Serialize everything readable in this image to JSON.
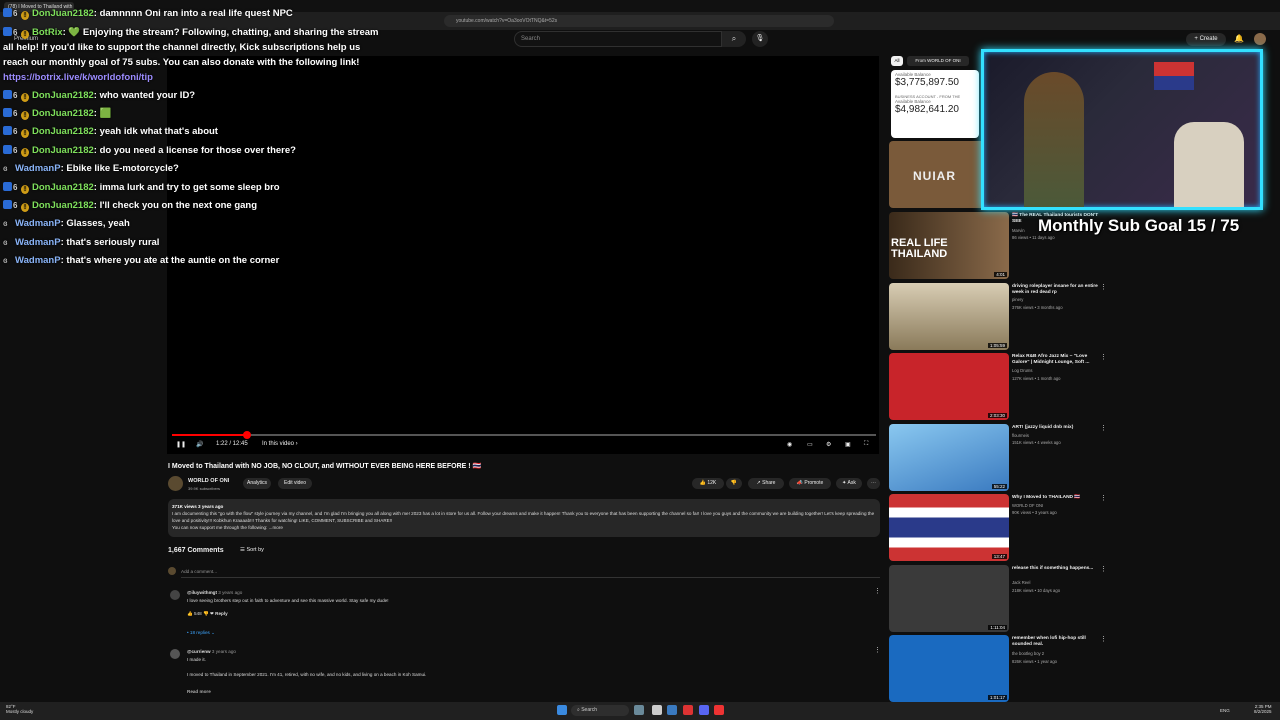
{
  "browser": {
    "tab_title": "(78) I Moved to Thailand with N...",
    "url": "youtube.com/watch?v=Oa3ooVOtTNQ&t=52s"
  },
  "youtube": {
    "search_placeholder": "Search",
    "create_label": "Create",
    "premium_label": "Premium",
    "player": {
      "time": "1:22 / 12:45",
      "chapter": "In this video ›"
    },
    "video_title": "I Moved to Thailand with NO JOB, NO CLOUT, and WITHOUT EVER BEING HERE BEFORE ! 🇹🇭",
    "channel_name": "WORLD OF ONI",
    "subscribers": "39.9K subscribers",
    "analytics_label": "Analytics",
    "edit_label": "Edit video",
    "likes": "12K",
    "share_label": "Share",
    "promote_label": "Promote",
    "ask_label": "Ask",
    "description": {
      "stats": "371K views  3 years ago",
      "text": "I am documenting this \"go with the flow\" style journey via my channel, and I'm glad I'm bringing you all along with me! 2023 has a lot in store for us all. Follow your dreams and make it happen! Thank you to everyone that has been supporting the channel so far! I love you guys and the community we are building together! Let's keep spreading the love and positivity!!! Kobkhun Kraaaab!!! Thanks for watching! LIKE, COMMENT, SUBSCRIBE and SHARE!!",
      "text2": "You can now support me through the following: ...more"
    },
    "comments": {
      "count": "1,667 Comments",
      "sort_label": "Sort by",
      "add_placeholder": "Add a comment...",
      "items": [
        {
          "author": "@iluywithmgt",
          "time": "3 years ago",
          "text": "I love seeing brothers step out in faith to adventure and see this massive world. Stay safe my dude!",
          "likes": "548",
          "reply_label": "Reply",
          "replies": "18 replies"
        },
        {
          "author": "@currienw",
          "time": "3 years ago",
          "text": "I made it.",
          "text2": "I moved to Thailand in September 2021.  I'm 41, retired, with no wife, and no kids, and living on a beach in Koh Samui.",
          "read_more": "Read more"
        }
      ]
    },
    "chips": {
      "all": "All",
      "from": "From WORLD OF ONI"
    },
    "recommended": [
      {
        "title": "",
        "channel": "",
        "meta": "",
        "duration": "",
        "thumb_color": "#7a5a3a"
      },
      {
        "title": "🇹🇭 The REAL Thailand tourists DON'T SEE",
        "channel": "Marvin",
        "meta": "86 views • 11 days ago",
        "duration": "4:01",
        "thumb_color": "#3a2a1a",
        "thumb_text": "REAL LIFE THAILAND"
      },
      {
        "title": "driving roleplayer insane for an entire week in red dead rp",
        "channel": "pinery",
        "meta": "376K views • 3 months ago",
        "duration": "1:05:59",
        "thumb_color": "#b4a58a"
      },
      {
        "title": "Relax R&B Afro Jazz Mix ~ \"Love Galore\" | Midnight Lounge, Soft ...",
        "channel": "Log Drums",
        "meta": "127K views • 1 month ago",
        "duration": "2:03:30",
        "thumb_color": "#c8242a"
      },
      {
        "title": "ART! (jazzy liquid dnb mix)",
        "channel": "flourmeis",
        "meta": "151K views • 4 weeks ago",
        "duration": "55:22",
        "thumb_color": "#5aa0e0"
      },
      {
        "title": "Why I Moved to THAILAND 🇹🇭",
        "channel": "WORLD OF ONI",
        "meta": "90K views • 3 years ago",
        "duration": "13:47",
        "thumb_color": "#2a3a6a"
      },
      {
        "title": "release this if something happens...",
        "channel": "Jack Reel",
        "meta": "218K views • 10 days ago",
        "duration": "1:11:04",
        "thumb_color": "#3a3a3a"
      },
      {
        "title": "remember when lofi hip-hop still sounded real.",
        "channel": "the bootleg boy 2",
        "meta": "826K views • 1 year ago",
        "duration": "1:01:17",
        "thumb_color": "#1a6ac0"
      }
    ]
  },
  "chat": {
    "lines": [
      {
        "user": "DonJuan2182",
        "color": "green",
        "badges": "s6w",
        "msg": ": damnnnn Oni ran into a real life quest NPC"
      },
      {
        "user": "BotRix",
        "color": "green",
        "badges": "s6w",
        "msg": ": 💚 Enjoying the stream? Following, chatting, and sharing the stream"
      },
      {
        "user": "",
        "color": "none",
        "badges": "",
        "msg": "all help! If you'd like to support the channel directly, Kick subscriptions help us"
      },
      {
        "user": "",
        "color": "none",
        "badges": "",
        "msg": "reach our monthly goal of 75 subs. You can also donate with the following link!"
      },
      {
        "user": "",
        "color": "link",
        "badges": "",
        "msg": "https://botrix.live/k/worldofoni/tip"
      },
      {
        "user": "DonJuan2182",
        "color": "green",
        "badges": "s6w",
        "msg": ": who wanted your ID?"
      },
      {
        "user": "DonJuan2182",
        "color": "green",
        "badges": "s6w",
        "msg": ": 🟩"
      },
      {
        "user": "DonJuan2182",
        "color": "green",
        "badges": "s6w",
        "msg": ": yeah idk what that's about"
      },
      {
        "user": "DonJuan2182",
        "color": "green",
        "badges": "s6w",
        "msg": ": do you need a license for those over there?"
      },
      {
        "user": "WadmanP",
        "color": "blue",
        "badges": "t",
        "msg": ": Ebike like E-motorcycle?"
      },
      {
        "user": "DonJuan2182",
        "color": "green",
        "badges": "s6w",
        "msg": ": imma lurk and try to get some sleep bro"
      },
      {
        "user": "DonJuan2182",
        "color": "green",
        "badges": "s6w",
        "msg": ": I'll check you on the next one gang"
      },
      {
        "user": "WadmanP",
        "color": "blue",
        "badges": "t",
        "msg": ": Glasses, yeah"
      },
      {
        "user": "WadmanP",
        "color": "blue",
        "badges": "t",
        "msg": ": that's seriously rural"
      },
      {
        "user": "WadmanP",
        "color": "blue",
        "badges": "t",
        "msg": ": that's where you ate at the auntie on the corner"
      }
    ]
  },
  "overlay": {
    "balance_label1": "Available Balance",
    "balance1": "$3,775,897.50",
    "balance_account": "BUSINESS ACCOUNT - FROM THE",
    "balance_label2": "Available Balance",
    "balance2": "$4,982,641.20",
    "sub_goal": "Monthly Sub Goal 15 / 75"
  },
  "taskbar": {
    "weather": "Mostly cloudy",
    "temp": "82°F",
    "search": "Search",
    "lang": "ENG",
    "time": "2:35 PM",
    "date": "8/2/2025"
  }
}
